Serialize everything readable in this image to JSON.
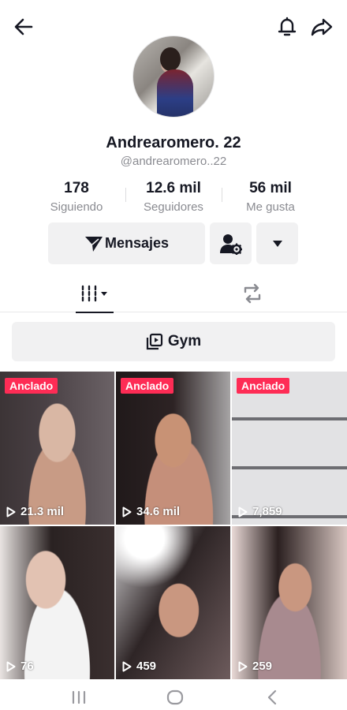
{
  "profile": {
    "display_name": "Andrearomero. 22",
    "handle": "@andrearomero..22",
    "avatar": "profile-photo"
  },
  "stats": [
    {
      "value": "178",
      "label": "Siguiendo"
    },
    {
      "value": "12.6 mil",
      "label": "Seguidores"
    },
    {
      "value": "56 mil",
      "label": "Me gusta"
    }
  ],
  "actions": {
    "message_label": "Mensajes"
  },
  "icons": {
    "back": "arrow-left-icon",
    "bell": "bell-icon",
    "share": "share-icon",
    "send": "send-icon",
    "follow_settings": "user-gear-icon",
    "more": "caret-down-icon",
    "grid": "grid-icon",
    "repost": "repost-icon",
    "playlist": "playlist-icon",
    "play": "play-icon"
  },
  "playlist": {
    "label": "Gym"
  },
  "videos": [
    {
      "pinned_label": "Anclado",
      "views": "21.3 mil"
    },
    {
      "pinned_label": "Anclado",
      "views": "34.6 mil"
    },
    {
      "pinned_label": "Anclado",
      "views": "7,859"
    },
    {
      "pinned_label": "",
      "views": "76"
    },
    {
      "pinned_label": "",
      "views": "459"
    },
    {
      "pinned_label": "",
      "views": "259"
    }
  ],
  "colors": {
    "accent": "#fe2c55",
    "text_primary": "#161823",
    "text_secondary": "#8a8b91",
    "button_bg": "#f1f1f2"
  }
}
